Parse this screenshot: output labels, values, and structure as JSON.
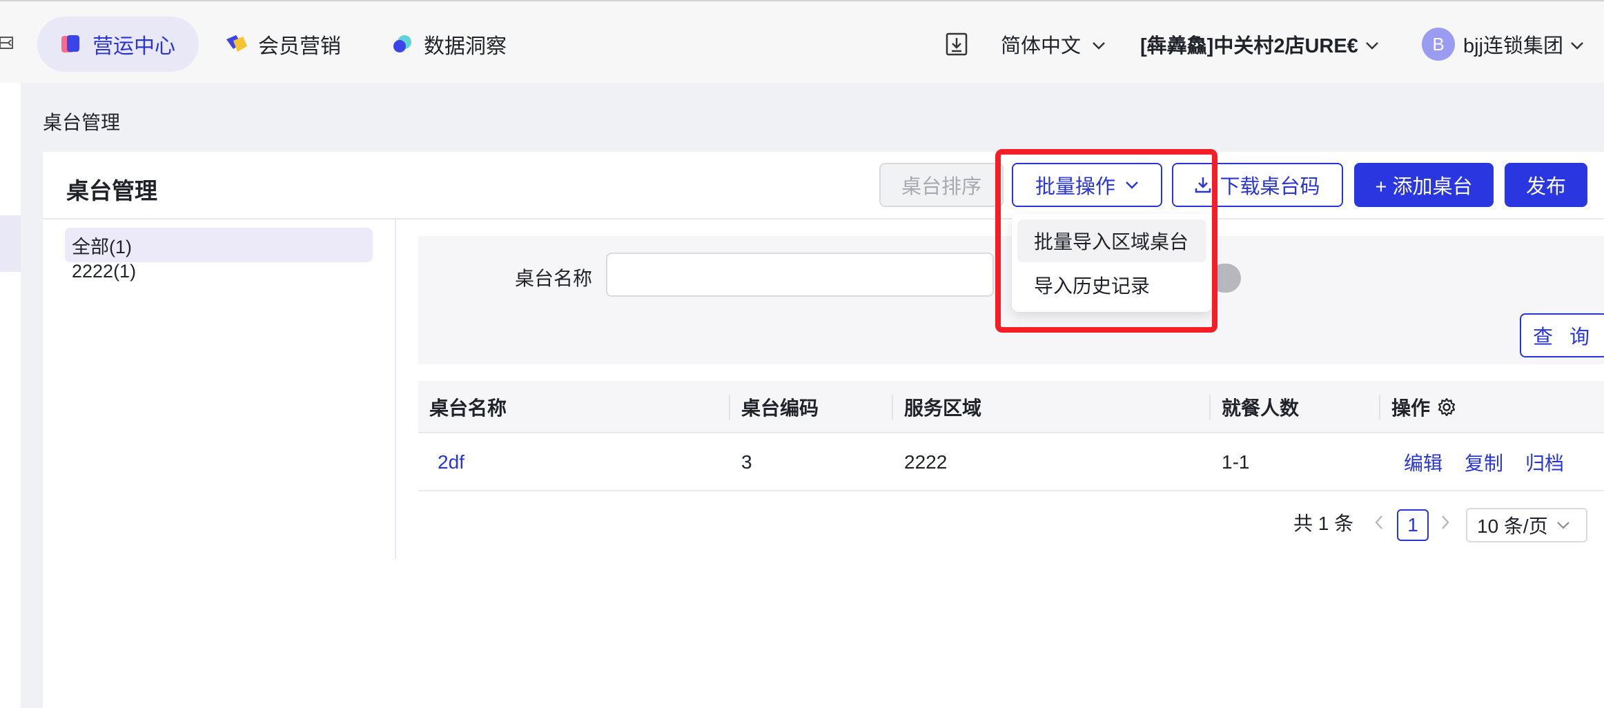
{
  "header": {
    "tabs": [
      {
        "label": "营运中心",
        "active": true,
        "icon": "operations-icon"
      },
      {
        "label": "会员营销",
        "active": false,
        "icon": "member-marketing-icon"
      },
      {
        "label": "数据洞察",
        "active": false,
        "icon": "data-insight-icon"
      }
    ],
    "language": "简体中文",
    "store": "[犇羴鱻]中关村2店URE€",
    "user": {
      "avatar_letter": "B",
      "name": "bjj连锁集团"
    }
  },
  "breadcrumb": "桌台管理",
  "card": {
    "title": "桌台管理",
    "buttons": {
      "sort": "桌台排序",
      "bulk": "批量操作",
      "download": "下载桌台码",
      "add": "+ 添加桌台",
      "publish": "发布"
    }
  },
  "tree": {
    "items": [
      {
        "label": "全部(1)",
        "selected": true
      },
      {
        "label": "2222(1)",
        "selected": false
      }
    ]
  },
  "filter": {
    "label": "桌台名称",
    "value": "",
    "placeholder": "",
    "query_button": "查 询"
  },
  "table": {
    "columns": [
      "桌台名称",
      "桌台编码",
      "服务区域",
      "就餐人数",
      "操作"
    ],
    "rows": [
      {
        "name": "2df",
        "code": "3",
        "area": "2222",
        "seats": "1-1",
        "actions": [
          "编辑",
          "复制",
          "归档"
        ]
      }
    ]
  },
  "pagination": {
    "total": "共 1 条",
    "current": "1",
    "page_size": "10 条/页"
  },
  "dropdown": {
    "items": [
      "批量导入区域桌台",
      "导入历史记录"
    ]
  },
  "colors": {
    "primary": "#2a36e0",
    "highlight": "#f41f26",
    "active_tab_bg": "#e8e8f7"
  }
}
